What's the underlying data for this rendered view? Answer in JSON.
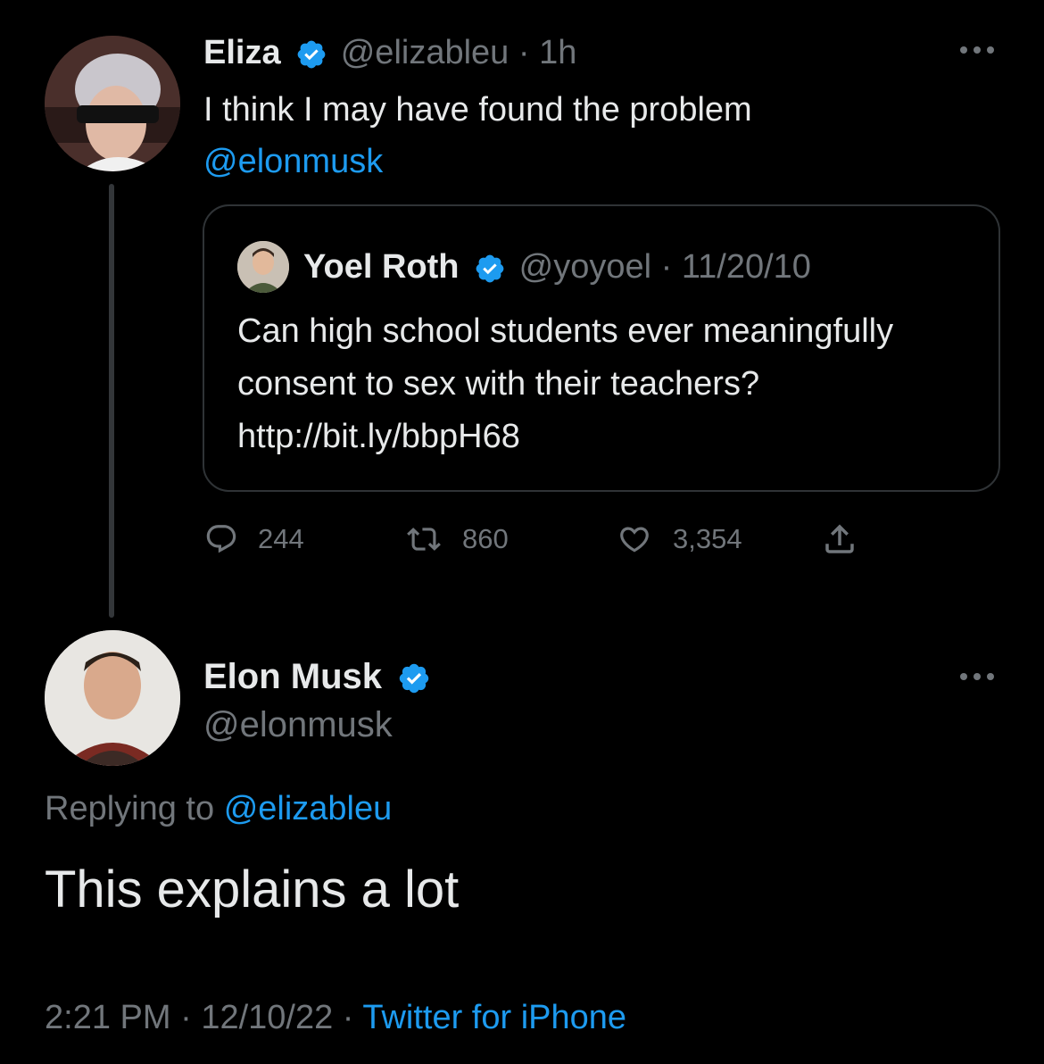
{
  "tweet1": {
    "name": "Eliza",
    "handle": "@elizableu",
    "time": "1h",
    "text": "I think I may have found the problem",
    "mention": "@elonmusk",
    "avatar_icon": "user-avatar-eliza"
  },
  "quote": {
    "name": "Yoel Roth",
    "handle": "@yoyoel",
    "date": "11/20/10",
    "text": "Can high school students ever meaningfully consent to sex with their teachers? http://bit.ly/bbpH68",
    "avatar_icon": "user-avatar-yoel"
  },
  "actions": {
    "replies": "244",
    "retweets": "860",
    "likes": "3,354"
  },
  "tweet2": {
    "name": "Elon Musk",
    "handle": "@elonmusk",
    "replying_prefix": "Replying to",
    "replying_to": "@elizableu",
    "text": "This explains a lot",
    "time": "2:21 PM",
    "date": "12/10/22",
    "source": "Twitter for iPhone",
    "avatar_icon": "user-avatar-elon"
  },
  "colors": {
    "background": "#000000",
    "text": "#e7e9ea",
    "muted": "#71767b",
    "accent": "#1d9bf0",
    "border": "#2f3336"
  }
}
